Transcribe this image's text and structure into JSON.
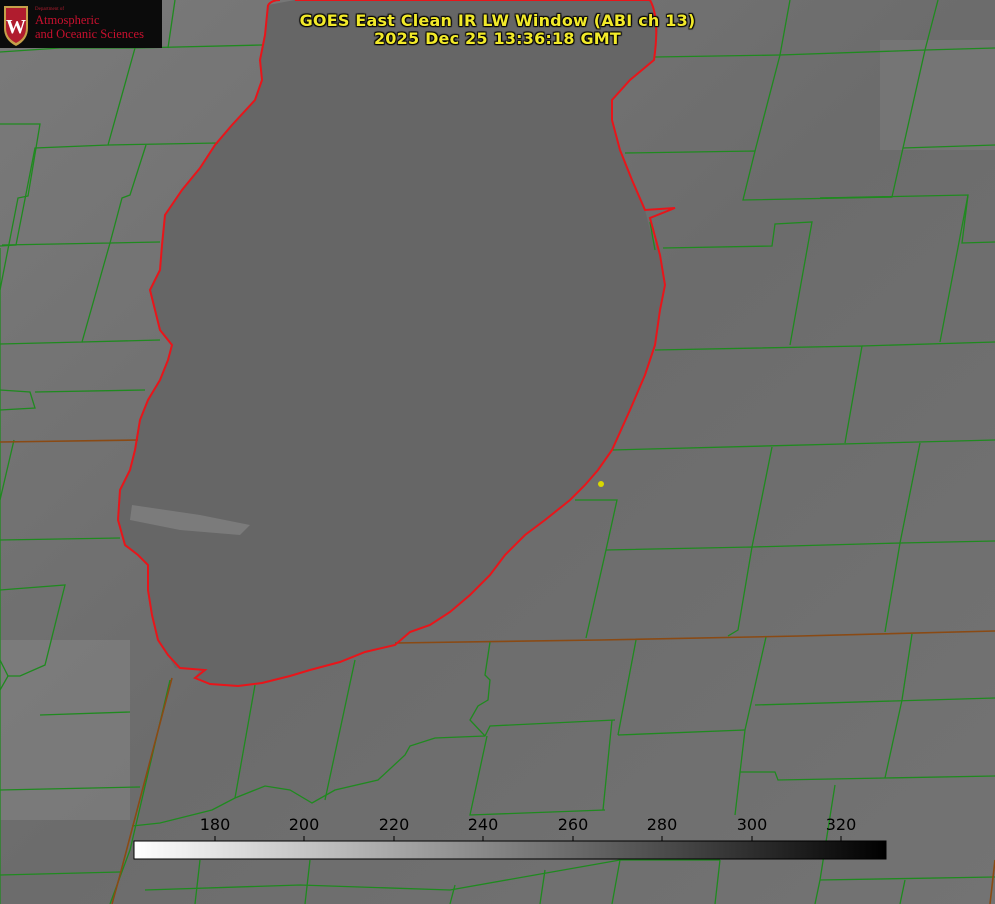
{
  "title": {
    "line1": "GOES East Clean IR LW Window (ABI ch 13)",
    "line2": "2025 Dec 25 13:36:18 GMT"
  },
  "logo": {
    "dept": "Department of",
    "line1": "Atmospheric",
    "line2": "and Oceanic Sciences",
    "emblem": "W"
  },
  "colorbar": {
    "ticks": [
      "180",
      "200",
      "220",
      "240",
      "260",
      "280",
      "300",
      "320"
    ],
    "range": [
      162,
      330
    ],
    "gradient": "white-to-black"
  },
  "colors": {
    "lakeshore": "#e8151a",
    "county_lines": "#1f8a1f",
    "state_lines": "#8a4a14",
    "marker": "#d8d800",
    "title_text": "#f2ea2a"
  }
}
